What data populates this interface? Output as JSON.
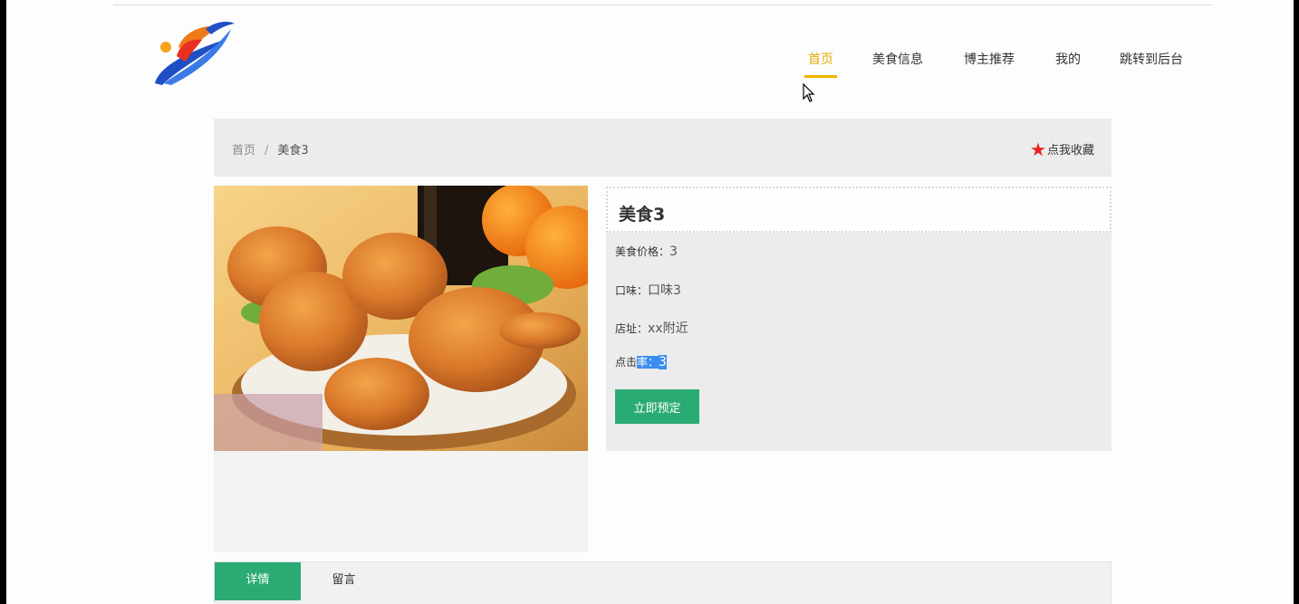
{
  "header": {
    "nav": [
      {
        "label": "首页",
        "active": true
      },
      {
        "label": "美食信息",
        "active": false
      },
      {
        "label": "博主推荐",
        "active": false
      },
      {
        "label": "我的",
        "active": false
      },
      {
        "label": "跳转到后台",
        "active": false
      }
    ],
    "accent_color": "#f0b400"
  },
  "breadcrumb": {
    "home": "首页",
    "separator": "/",
    "current": "美食3"
  },
  "favorite": {
    "icon": "star-icon",
    "label": "点我收藏"
  },
  "food": {
    "title": "美食3",
    "price_label": "美食价格：",
    "price_value": "3",
    "taste_label": "口味：",
    "taste_value": "口味3",
    "address_label": "店址：",
    "address_value": "xx附近",
    "clicks_label_a": "点击",
    "clicks_label_b": "率：",
    "clicks_value": "3",
    "book_button": "立即预定"
  },
  "tabs": [
    {
      "label": "详情",
      "active": true
    },
    {
      "label": "留言",
      "active": false
    }
  ],
  "colors": {
    "primary_green": "#2bab74",
    "selection_blue": "#3b8dee",
    "star_red": "#e8211e"
  }
}
